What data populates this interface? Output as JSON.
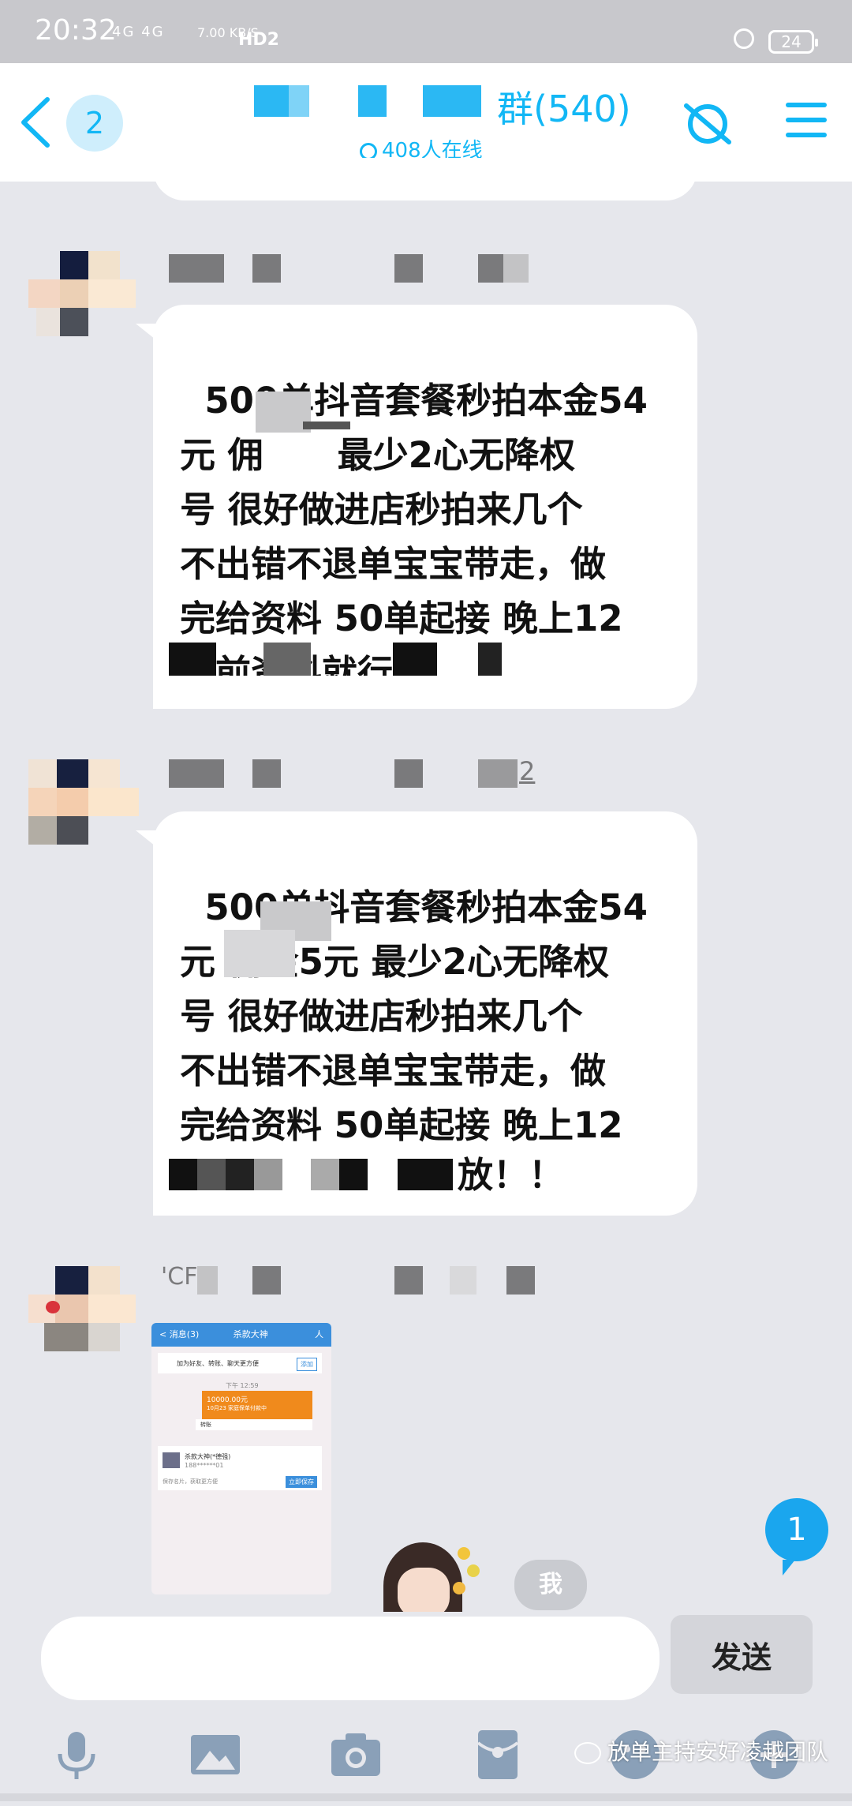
{
  "status_bar": {
    "time": "20:32",
    "network": "4G 4G",
    "speed": "7.00 KB/S",
    "hd": "HD2",
    "battery": "24"
  },
  "header": {
    "unread_count": "2",
    "group_title_suffix": "群(540)",
    "online_text": "408人在线"
  },
  "messages": [
    {
      "text": "500单抖音套餐秒拍本金54\n元 佣      最少2心无降权\n号 很好做进店秒拍来几个\n不出错不退单宝宝带走，做\n完给资料 50单起接 晚上12\n点前资料就行"
    },
    {
      "sender_suffix": "2",
      "text": "500单抖音套餐秒拍本金54\n元 佣金5元 最少2心无降权\n号 很好做进店秒拍来几个\n不出错不退单宝宝带走，做\n完给资料 50单起接 晚上12\n点前资料就行",
      "last_line_tail": "放！！"
    },
    {
      "sender_prefix": "'CF",
      "image": {
        "header_left": "< 消息(3)",
        "header_title": "杀款大神",
        "header_right": "人",
        "notice_text": "加为好友、转账、聊天更方便",
        "notice_button": "添加",
        "time": "下午 12:59",
        "order_amount": "10000.00元",
        "order_sub": "10月23 家庭保单付款中",
        "order_footer": "转账",
        "card_name": "杀款大神(*德强)",
        "card_sub": "188******01",
        "card_footer": "保存名片，获取更方便",
        "card_button": "立即保存"
      }
    }
  ],
  "unread_new": "1",
  "sticker_text": "我",
  "input": {
    "placeholder": "",
    "send_label": "发送"
  },
  "watermark": "放单主持安好凌越团队",
  "colors": {
    "accent": "#12b7f5",
    "background": "#e6e7ec",
    "bubble": "#ffffff",
    "unread_badge": "#1aa6ee"
  }
}
